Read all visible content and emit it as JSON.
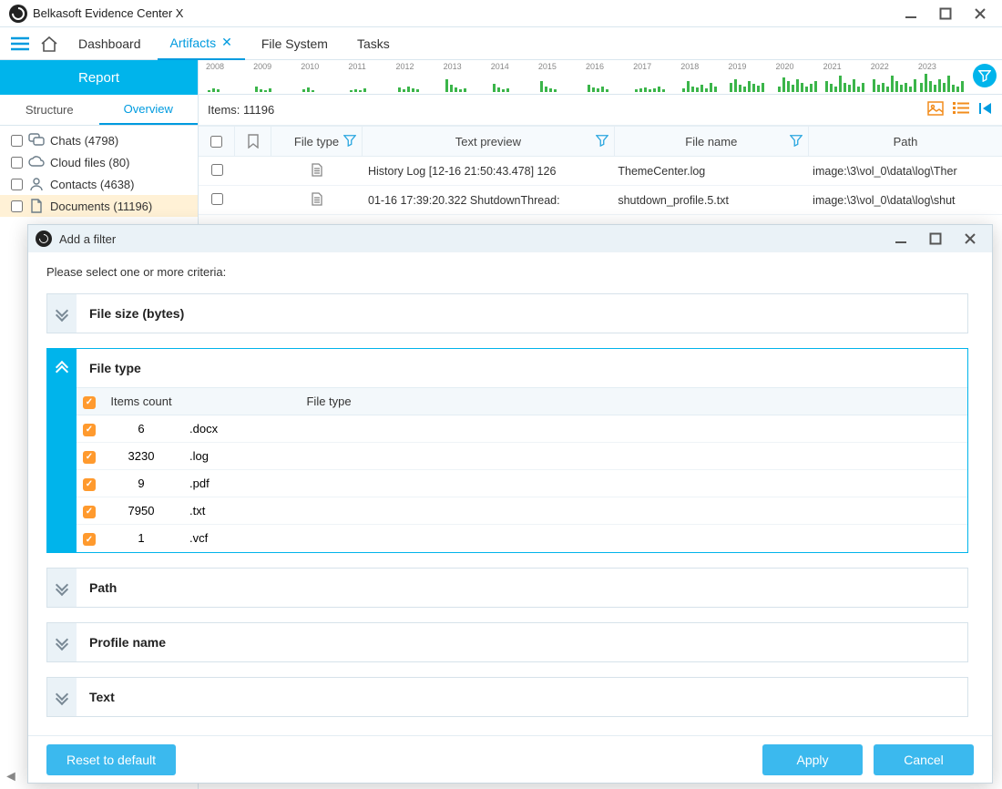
{
  "app": {
    "title": "Belkasoft Evidence Center X"
  },
  "nav": {
    "items": [
      {
        "label": "Dashboard",
        "active": false
      },
      {
        "label": "Artifacts",
        "active": true
      },
      {
        "label": "File System",
        "active": false
      },
      {
        "label": "Tasks",
        "active": false
      }
    ],
    "report_button": "Report"
  },
  "sidebar": {
    "tabs": {
      "structure": "Structure",
      "overview": "Overview"
    },
    "rows": [
      {
        "label": "Chats (4798)",
        "icon": "chat"
      },
      {
        "label": "Cloud files (80)",
        "icon": "cloud"
      },
      {
        "label": "Contacts (4638)",
        "icon": "contact"
      },
      {
        "label": "Documents (11196)",
        "icon": "document",
        "selected": true
      }
    ]
  },
  "timeline_years": [
    "2008",
    "2009",
    "2010",
    "2011",
    "2012",
    "2013",
    "2014",
    "2015",
    "2016",
    "2017",
    "2018",
    "2019",
    "2020",
    "2021",
    "2022",
    "2023"
  ],
  "items": {
    "count_label": "Items: 11196",
    "columns": {
      "file_type": "File type",
      "text_preview": "Text preview",
      "file_name": "File name",
      "path": "Path"
    },
    "rows": [
      {
        "preview": "History Log [12-16 21:50:43.478] 126",
        "filename": "ThemeCenter.log",
        "path": "image:\\3\\vol_0\\data\\log\\Ther"
      },
      {
        "preview": "01-16 17:39:20.322 ShutdownThread:",
        "filename": "shutdown_profile.5.txt",
        "path": "image:\\3\\vol_0\\data\\log\\shut"
      }
    ]
  },
  "modal": {
    "title": "Add a filter",
    "prompt": "Please select one or more criteria:",
    "criteria": {
      "file_size": "File size (bytes)",
      "file_type": "File type",
      "path": "Path",
      "profile_name": "Profile name",
      "text": "Text"
    },
    "ft_table": {
      "columns": {
        "count": "Items count",
        "type": "File type"
      },
      "rows": [
        {
          "count": "6",
          "type": ".docx"
        },
        {
          "count": "3230",
          "type": ".log"
        },
        {
          "count": "9",
          "type": ".pdf"
        },
        {
          "count": "7950",
          "type": ".txt"
        },
        {
          "count": "1",
          "type": ".vcf"
        }
      ]
    },
    "buttons": {
      "reset": "Reset to default",
      "apply": "Apply",
      "cancel": "Cancel"
    }
  }
}
